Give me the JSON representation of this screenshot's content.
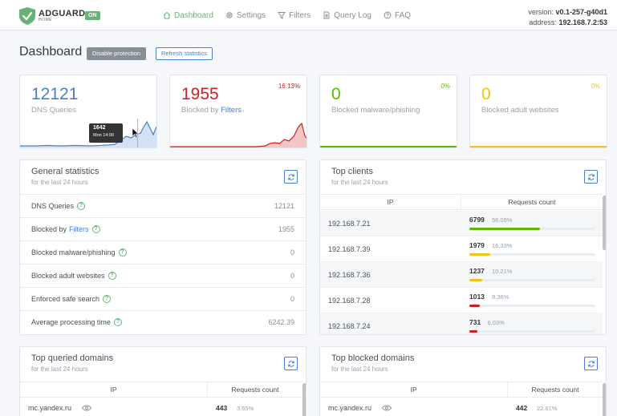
{
  "header": {
    "brand": "ADGUARD",
    "brand_sub": "HOME",
    "status_badge": "ON",
    "nav": [
      {
        "label": "Dashboard",
        "icon": "home-icon",
        "active": true
      },
      {
        "label": "Settings",
        "icon": "gear-icon"
      },
      {
        "label": "Filters",
        "icon": "filter-icon"
      },
      {
        "label": "Query Log",
        "icon": "document-icon"
      },
      {
        "label": "FAQ",
        "icon": "help-circle-icon"
      }
    ],
    "version_label": "version:",
    "version_value": "v0.1-257-g40d1",
    "address_label": "address:",
    "address_value": "192.168.7.2:53"
  },
  "page": {
    "title": "Dashboard",
    "disable_btn": "Disable protection",
    "refresh_btn": "Refresh statistics"
  },
  "stats": {
    "dns": {
      "value": "12121",
      "label": "DNS Queries",
      "color": "#467fcf"
    },
    "blocked": {
      "value": "1955",
      "label_prefix": "Blocked by ",
      "label_link": "Filters",
      "pct": "16.13%",
      "color": "#cd201f"
    },
    "malware": {
      "value": "0",
      "label": "Blocked malware/phishing",
      "pct": "0%",
      "color": "#5eba00"
    },
    "adult": {
      "value": "0",
      "label": "Blocked adult websites",
      "pct": "0%",
      "color": "#f1c40f"
    },
    "tooltip": {
      "value": "1642",
      "time": "Mon 14:00"
    }
  },
  "general": {
    "title": "General statistics",
    "subtitle": "for the last 24 hours",
    "rows": [
      {
        "label": "DNS Queries",
        "value": "12121"
      },
      {
        "label": "Blocked by",
        "link": "Filters",
        "value": "1955"
      },
      {
        "label": "Blocked malware/phishing",
        "value": "0"
      },
      {
        "label": "Blocked adult websites",
        "value": "0"
      },
      {
        "label": "Enforced safe search",
        "value": "0"
      },
      {
        "label": "Average processing time",
        "value": "6242.39"
      }
    ]
  },
  "clients": {
    "title": "Top clients",
    "subtitle": "for the last 24 hours",
    "col_ip": "IP",
    "col_count": "Requests count",
    "rows": [
      {
        "ip": "192.168.7.21",
        "count": "6799",
        "pct": "56.09%",
        "frac": 0.5609,
        "color": "#5eba00"
      },
      {
        "ip": "192.168.7.39",
        "count": "1979",
        "pct": "16.33%",
        "frac": 0.1633,
        "color": "#f1c40f"
      },
      {
        "ip": "192.168.7.36",
        "count": "1237",
        "pct": "10.21%",
        "frac": 0.1021,
        "color": "#f1c40f"
      },
      {
        "ip": "192.168.7.28",
        "count": "1013",
        "pct": "8.36%",
        "frac": 0.0836,
        "color": "#cd201f"
      },
      {
        "ip": "192.168.7.24",
        "count": "731",
        "pct": "6.03%",
        "frac": 0.0603,
        "color": "#cd201f"
      }
    ]
  },
  "queried": {
    "title": "Top queried domains",
    "subtitle": "for the last 24 hours",
    "col_ip": "IP",
    "col_count": "Requests count",
    "row": {
      "domain": "mc.yandex.ru",
      "count": "443",
      "pct": "3.65%"
    }
  },
  "blocked_domains": {
    "title": "Top blocked domains",
    "subtitle": "for the last 24 hours",
    "col_ip": "IP",
    "col_count": "Requests count",
    "row": {
      "domain": "mc.yandex.ru",
      "count": "442",
      "pct": "22.61%"
    }
  }
}
